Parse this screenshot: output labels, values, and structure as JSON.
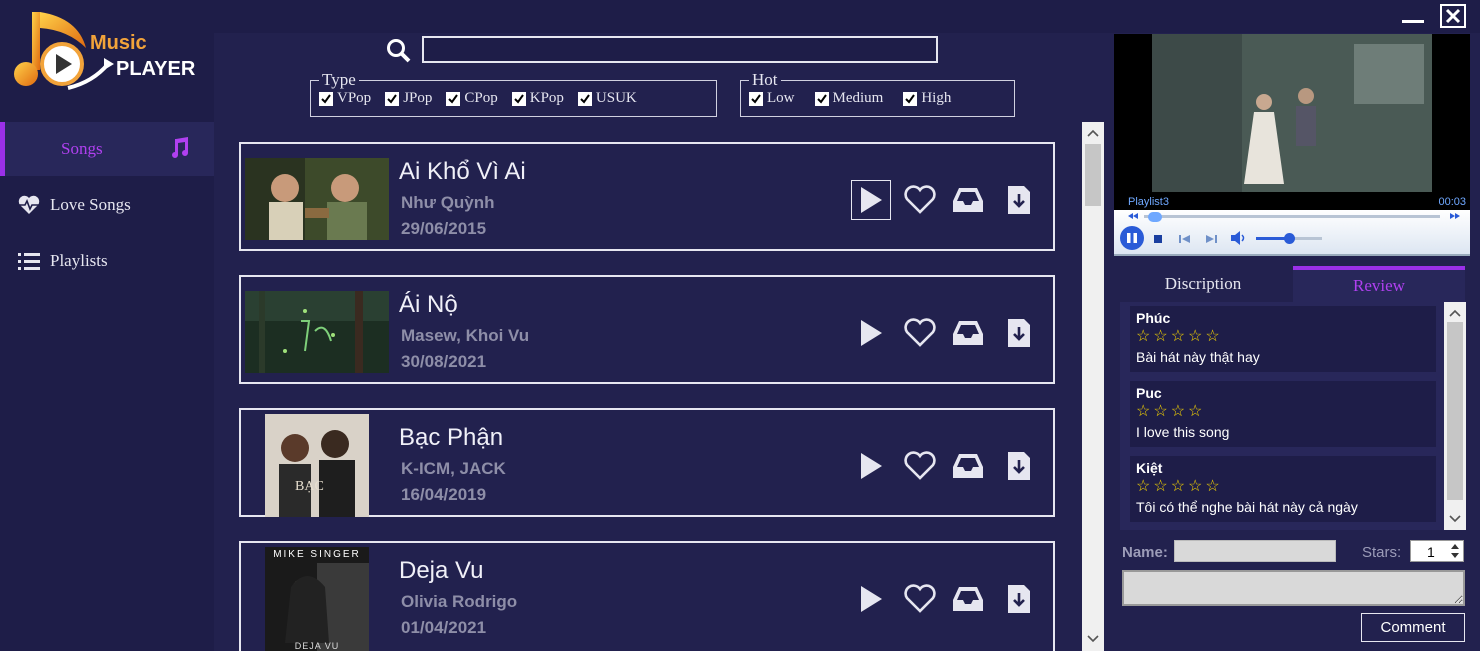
{
  "app": {
    "logo_line1": "Music",
    "logo_line2": "PLAYER"
  },
  "sidebar": {
    "items": [
      {
        "label": "Songs",
        "icon": "music-note-icon",
        "active": true
      },
      {
        "label": "Love Songs",
        "icon": "heart-pulse-icon",
        "active": false
      },
      {
        "label": "Playlists",
        "icon": "list-icon",
        "active": false
      }
    ]
  },
  "search": {
    "value": "",
    "placeholder": ""
  },
  "filters": {
    "type": {
      "legend": "Type",
      "options": [
        "VPop",
        "JPop",
        "CPop",
        "KPop",
        "USUK"
      ],
      "checked": [
        true,
        true,
        true,
        true,
        true
      ]
    },
    "hot": {
      "legend": "Hot",
      "options": [
        "Low",
        "Medium",
        "High"
      ],
      "checked": [
        true,
        true,
        true
      ]
    }
  },
  "songs": [
    {
      "title": "Ai Khổ Vì Ai",
      "artist": "Như Quỳnh",
      "date": "29/06/2015"
    },
    {
      "title": "Ái Nộ",
      "artist": "Masew, Khoi Vu",
      "date": "30/08/2021"
    },
    {
      "title": "Bạc Phận",
      "artist": "K-ICM, JACK",
      "date": "16/04/2019"
    },
    {
      "title": "Deja Vu",
      "artist": "Olivia Rodrigo",
      "date": "01/04/2021",
      "cover_text_top": "MIKE SINGER",
      "cover_text_bottom": "DEJA VU"
    }
  ],
  "player": {
    "playlist": "Playlist3",
    "time": "00:03",
    "progress": 0.06,
    "volume": 0.5
  },
  "tabs": [
    {
      "label": "Discription",
      "active": false
    },
    {
      "label": "Review",
      "active": true
    }
  ],
  "reviews": [
    {
      "name": "Phúc",
      "stars": "☆☆☆☆☆",
      "comment": "Bài hát này thật hay"
    },
    {
      "name": "Puc",
      "stars": "☆☆☆☆",
      "comment": "I love this song"
    },
    {
      "name": "Kiệt",
      "stars": "☆☆☆☆☆",
      "comment": "Tôi có thể nghe bài hát này cả ngày"
    }
  ],
  "review_form": {
    "name_label": "Name:",
    "stars_label": "Stars:",
    "stars_value": "1",
    "comment_button": "Comment"
  },
  "colors": {
    "background": "#22214e",
    "accent": "#9b30e8",
    "star": "#f5d400"
  }
}
